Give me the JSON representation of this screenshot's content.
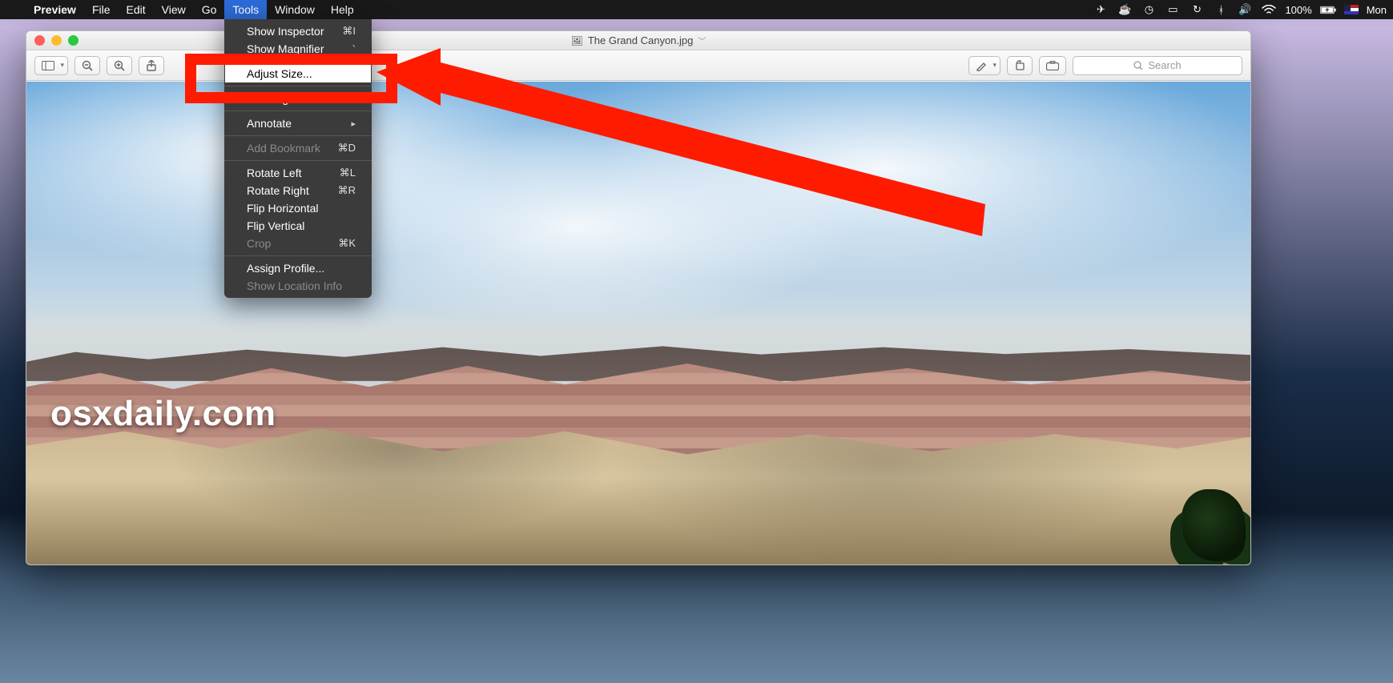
{
  "menubar": {
    "apple": "",
    "app": "Preview",
    "items": [
      "File",
      "Edit",
      "View",
      "Go",
      "Tools",
      "Window",
      "Help"
    ],
    "active": "Tools",
    "status": {
      "battery_pct": "100%",
      "day": "Mon"
    }
  },
  "dropdown": {
    "items": [
      {
        "label": "Show Inspector",
        "shortcut": "⌘I"
      },
      {
        "label": "Show Magnifier",
        "shortcut": "`"
      },
      {
        "sep": true
      },
      {
        "label": "Adjust Size...",
        "highlight": true
      },
      {
        "sep": true
      },
      {
        "label": "Rectangular Selection",
        "checked": true
      },
      {
        "sep": true
      },
      {
        "label": "Annotate",
        "submenu": true
      },
      {
        "sep": true
      },
      {
        "label": "Add Bookmark",
        "shortcut": "⌘D",
        "disabled": true
      },
      {
        "sep": true
      },
      {
        "label": "Rotate Left",
        "shortcut": "⌘L"
      },
      {
        "label": "Rotate Right",
        "shortcut": "⌘R"
      },
      {
        "label": "Flip Horizontal"
      },
      {
        "label": "Flip Vertical"
      },
      {
        "label": "Crop",
        "shortcut": "⌘K",
        "disabled": true
      },
      {
        "sep": true
      },
      {
        "label": "Assign Profile..."
      },
      {
        "label": "Show Location Info",
        "disabled": true
      }
    ]
  },
  "window": {
    "title": "The Grand Canyon.jpg",
    "search_placeholder": "Search"
  },
  "watermark": "osxdaily.com"
}
